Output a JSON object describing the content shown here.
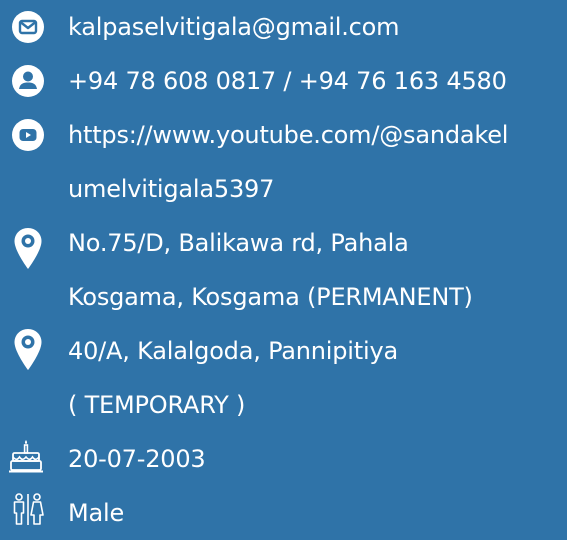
{
  "contact": {
    "email": "kalpaselvitigala@gmail.com",
    "phone": "+94 78 608 0817 / +94 76 163 4580",
    "youtube": [
      "https://www.youtube.com/@sandakel",
      "umelvitigala5397"
    ],
    "permanent_address": [
      "No.75/D, Balikawa rd, Pahala",
      "Kosgama, Kosgama (PERMANENT)"
    ],
    "temporary_address": [
      "40/A, Kalalgoda, Pannipitiya",
      "( TEMPORARY )"
    ],
    "birthday": "20-07-2003",
    "gender": "Male"
  },
  "icons": {
    "email": "envelope-icon",
    "phone": "user-icon",
    "youtube": "youtube-icon",
    "permanent_address": "location-pin-icon",
    "temporary_address": "location-pin-icon",
    "birthday": "birthday-cake-icon",
    "gender": "restroom-icon"
  },
  "colors": {
    "background": "#2F73A8",
    "foreground": "#FFFFFF"
  }
}
